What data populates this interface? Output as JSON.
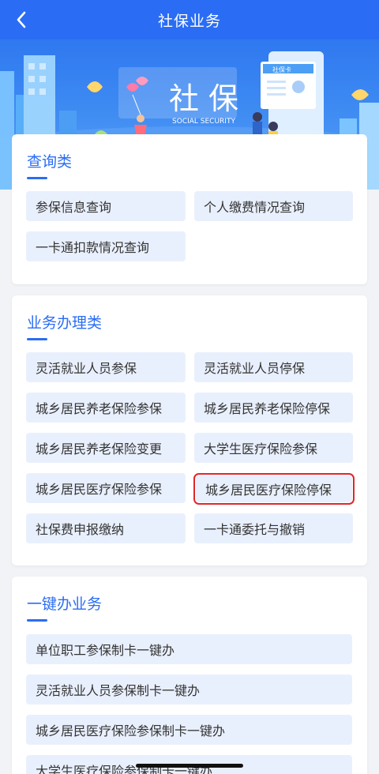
{
  "nav": {
    "title": "社保业务",
    "back_icon": "chevron-left-icon"
  },
  "banner": {
    "main_text": "社 保",
    "sub_text": "SOCIAL SECURITY",
    "card_text": "社保卡"
  },
  "sections": {
    "query": {
      "title": "查询类",
      "items": [
        "参保信息查询",
        "个人缴费情况查询",
        "一卡通扣款情况查询"
      ]
    },
    "business": {
      "title": "业务办理类",
      "items": [
        "灵活就业人员参保",
        "灵活就业人员停保",
        "城乡居民养老保险参保",
        "城乡居民养老保险停保",
        "城乡居民养老保险变更",
        "大学生医疗保险参保",
        "城乡居民医疗保险参保",
        "城乡居民医疗保险停保",
        "社保费申报缴纳",
        "一卡通委托与撤销"
      ]
    },
    "onekey": {
      "title": "一键办业务",
      "items": [
        "单位职工参保制卡一键办",
        "灵活就业人员参保制卡一键办",
        "城乡居民医疗保险参保制卡一键办",
        "大学生医疗保险参保制卡一键办"
      ]
    }
  },
  "colors": {
    "primary": "#2a6df4",
    "button_bg": "#e9f0fd",
    "highlight": "#e0262a"
  }
}
